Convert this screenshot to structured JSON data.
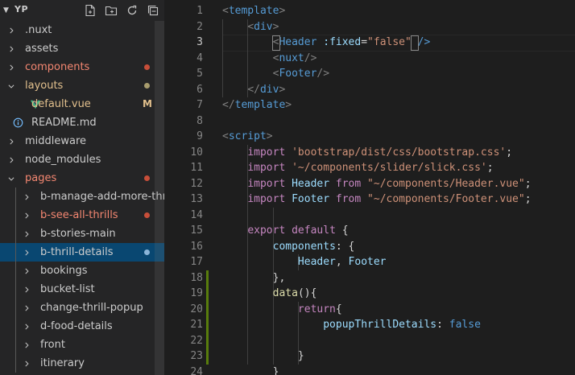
{
  "colors": {
    "modified": "#e2c08d",
    "folder_error": "#f48771",
    "error_dot": "#c74e39",
    "git_added_bar": "#587c0c",
    "selection": "#094771",
    "vue_green": "#41b883",
    "info_blue": "#75beff"
  },
  "sidebar": {
    "title": "YP",
    "actions": [
      {
        "name": "new-file-icon",
        "label": "New File"
      },
      {
        "name": "new-folder-icon",
        "label": "New Folder"
      },
      {
        "name": "refresh-icon",
        "label": "Refresh"
      },
      {
        "name": "collapse-all-icon",
        "label": "Collapse All"
      }
    ],
    "items": [
      {
        "label": ".nuxt",
        "type": "folder",
        "level": 0,
        "expanded": false
      },
      {
        "label": "assets",
        "type": "folder",
        "level": 0,
        "expanded": false
      },
      {
        "label": "components",
        "type": "folder",
        "level": 0,
        "expanded": false,
        "status": "error"
      },
      {
        "label": "layouts",
        "type": "folder",
        "level": 0,
        "expanded": true,
        "status": "modified"
      },
      {
        "label": "default.vue",
        "type": "vue",
        "level": 1,
        "status": "modified",
        "badge": "M"
      },
      {
        "label": "README.md",
        "type": "info",
        "level": 0
      },
      {
        "label": "middleware",
        "type": "folder",
        "level": 0,
        "expanded": false
      },
      {
        "label": "node_modules",
        "type": "folder",
        "level": 0,
        "expanded": false
      },
      {
        "label": "pages",
        "type": "folder",
        "level": 0,
        "expanded": true,
        "status": "error"
      },
      {
        "label": "b-manage-add-more-thrills",
        "type": "folder",
        "level": 1,
        "expanded": false
      },
      {
        "label": "b-see-all-thrills",
        "type": "folder",
        "level": 1,
        "expanded": false,
        "status": "error"
      },
      {
        "label": "b-stories-main",
        "type": "folder",
        "level": 1,
        "expanded": false
      },
      {
        "label": "b-thrill-details",
        "type": "folder",
        "level": 1,
        "expanded": false,
        "selected": true
      },
      {
        "label": "bookings",
        "type": "folder",
        "level": 1,
        "expanded": false
      },
      {
        "label": "bucket-list",
        "type": "folder",
        "level": 1,
        "expanded": false
      },
      {
        "label": "change-thrill-popup",
        "type": "folder",
        "level": 1,
        "expanded": false
      },
      {
        "label": "d-food-details",
        "type": "folder",
        "level": 1,
        "expanded": false
      },
      {
        "label": "front",
        "type": "folder",
        "level": 1,
        "expanded": false
      },
      {
        "label": "itinerary",
        "type": "folder",
        "level": 1,
        "expanded": false
      }
    ]
  },
  "editor": {
    "lines": [
      {
        "n": "1",
        "t": [
          [
            "tag",
            "<template>"
          ]
        ]
      },
      {
        "n": "2",
        "t": [
          [
            "pun",
            "    "
          ],
          [
            "tag",
            "<div>"
          ]
        ]
      },
      {
        "n": "3",
        "t": [
          [
            "pun",
            "        "
          ],
          [
            "tag",
            "<Header"
          ],
          [
            "pun",
            " "
          ],
          [
            "attr",
            ":fixed"
          ],
          [
            "pun",
            "="
          ],
          [
            "str",
            "\"false\""
          ],
          [
            "pun",
            " "
          ],
          [
            "tag",
            "/>"
          ]
        ]
      },
      {
        "n": "4",
        "t": [
          [
            "pun",
            "        "
          ],
          [
            "tag",
            "<nuxt/>"
          ]
        ]
      },
      {
        "n": "5",
        "t": [
          [
            "pun",
            "        "
          ],
          [
            "tag",
            "<Footer/>"
          ]
        ]
      },
      {
        "n": "6",
        "t": [
          [
            "pun",
            "    "
          ],
          [
            "tag",
            "</div>"
          ]
        ]
      },
      {
        "n": "7",
        "t": [
          [
            "tag",
            "</template>"
          ]
        ]
      },
      {
        "n": "8",
        "t": []
      },
      {
        "n": "9",
        "t": [
          [
            "tag",
            "<script>"
          ]
        ]
      },
      {
        "n": "10",
        "t": [
          [
            "pun",
            "    "
          ],
          [
            "kw",
            "import"
          ],
          [
            "pun",
            " "
          ],
          [
            "str",
            "'bootstrap/dist/css/bootstrap.css'"
          ],
          [
            "pun",
            ";"
          ]
        ]
      },
      {
        "n": "11",
        "t": [
          [
            "pun",
            "    "
          ],
          [
            "kw",
            "import"
          ],
          [
            "pun",
            " "
          ],
          [
            "str",
            "'~/components/slider/slick.css'"
          ],
          [
            "pun",
            ";"
          ]
        ]
      },
      {
        "n": "12",
        "t": [
          [
            "pun",
            "    "
          ],
          [
            "kw",
            "import"
          ],
          [
            "pun",
            " "
          ],
          [
            "var",
            "Header"
          ],
          [
            "pun",
            " "
          ],
          [
            "kw",
            "from"
          ],
          [
            "pun",
            " "
          ],
          [
            "str",
            "\"~/components/Header.vue\""
          ],
          [
            "pun",
            ";"
          ]
        ]
      },
      {
        "n": "13",
        "t": [
          [
            "pun",
            "    "
          ],
          [
            "kw",
            "import"
          ],
          [
            "pun",
            " "
          ],
          [
            "var",
            "Footer"
          ],
          [
            "pun",
            " "
          ],
          [
            "kw",
            "from"
          ],
          [
            "pun",
            " "
          ],
          [
            "str",
            "\"~/components/Footer.vue\""
          ],
          [
            "pun",
            ";"
          ]
        ]
      },
      {
        "n": "14",
        "t": []
      },
      {
        "n": "15",
        "t": [
          [
            "pun",
            "    "
          ],
          [
            "kw",
            "export"
          ],
          [
            "pun",
            " "
          ],
          [
            "kw",
            "default"
          ],
          [
            "pun",
            " {"
          ]
        ]
      },
      {
        "n": "16",
        "t": [
          [
            "pun",
            "        "
          ],
          [
            "var",
            "components"
          ],
          [
            "pun",
            ": {"
          ]
        ]
      },
      {
        "n": "17",
        "t": [
          [
            "pun",
            "            "
          ],
          [
            "var",
            "Header"
          ],
          [
            "pun",
            ", "
          ],
          [
            "var",
            "Footer"
          ]
        ]
      },
      {
        "n": "18",
        "t": [
          [
            "pun",
            "        },"
          ]
        ]
      },
      {
        "n": "19",
        "t": [
          [
            "pun",
            "        "
          ],
          [
            "fn",
            "data"
          ],
          [
            "pun",
            "(){"
          ]
        ]
      },
      {
        "n": "20",
        "t": [
          [
            "pun",
            "            "
          ],
          [
            "kw",
            "return"
          ],
          [
            "pun",
            "{"
          ]
        ]
      },
      {
        "n": "21",
        "t": [
          [
            "pun",
            "                "
          ],
          [
            "var",
            "popupThrillDetails"
          ],
          [
            "pun",
            ": "
          ],
          [
            "bool",
            "false"
          ]
        ]
      },
      {
        "n": "22",
        "t": []
      },
      {
        "n": "23",
        "t": [
          [
            "pun",
            "            }"
          ]
        ]
      },
      {
        "n": "24",
        "t": [
          [
            "pun",
            "        }"
          ]
        ]
      }
    ]
  }
}
